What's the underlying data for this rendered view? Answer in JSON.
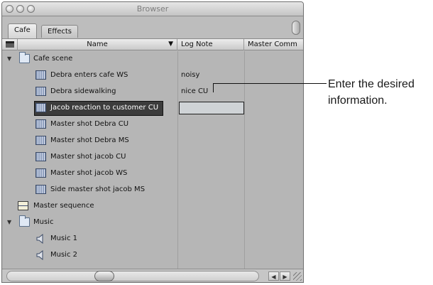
{
  "window": {
    "title": "Browser"
  },
  "tabs": [
    {
      "label": "Cafe",
      "active": true
    },
    {
      "label": "Effects",
      "active": false
    }
  ],
  "columns": {
    "name": "Name",
    "log_note": "Log Note",
    "master": "Master Comm"
  },
  "rows": [
    {
      "label": "Cafe scene",
      "type": "folder",
      "expanded": true,
      "indent": 0,
      "log": ""
    },
    {
      "label": "Debra enters cafe WS",
      "type": "clip",
      "indent": 1,
      "log": "noisy"
    },
    {
      "label": "Debra sidewalking",
      "type": "clip",
      "indent": 1,
      "log": "nice CU"
    },
    {
      "label": "Jacob reaction to customer CU",
      "type": "clip",
      "indent": 1,
      "log": "",
      "selected": true,
      "editing": true
    },
    {
      "label": "Master shot Debra CU",
      "type": "clip",
      "indent": 1,
      "log": ""
    },
    {
      "label": "Master shot Debra MS",
      "type": "clip",
      "indent": 1,
      "log": ""
    },
    {
      "label": "Master shot jacob CU",
      "type": "clip",
      "indent": 1,
      "log": ""
    },
    {
      "label": "Master shot jacob WS",
      "type": "clip",
      "indent": 1,
      "log": ""
    },
    {
      "label": "Side master shot jacob MS",
      "type": "clip",
      "indent": 1,
      "log": ""
    },
    {
      "label": "Master sequence",
      "type": "sequence",
      "indent": 0,
      "log": ""
    },
    {
      "label": "Music",
      "type": "folder",
      "expanded": true,
      "indent": 0,
      "log": ""
    },
    {
      "label": "Music 1",
      "type": "audio",
      "indent": 1,
      "log": ""
    },
    {
      "label": "Music 2",
      "type": "audio",
      "indent": 1,
      "log": ""
    }
  ],
  "callout": {
    "line1": "Enter the desired",
    "line2": "information."
  },
  "icons": {
    "folder": "folder-icon",
    "clip": "clip-icon",
    "sequence": "sequence-icon",
    "audio": "speaker-icon",
    "disclosure": "disclosure-triangle-icon",
    "sort": "sort-triangle-icon"
  }
}
